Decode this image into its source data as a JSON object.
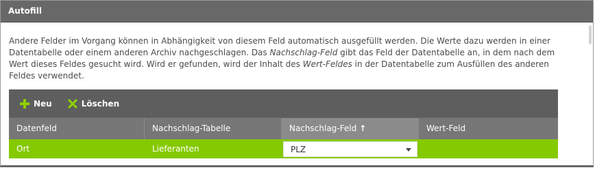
{
  "panel": {
    "title": "Autofill"
  },
  "description": {
    "part1": "Andere Felder im Vorgang können in Abhängigkeit von diesem Feld automatisch ausgefüllt werden. Die Werte dazu werden in einer Datentabelle oder einem anderen Archiv nachgeschlagen. Das ",
    "em1": "Nachschlag-Feld",
    "part2": " gibt das Feld der Datentabelle an, in dem nach dem Wert dieses Feldes gesucht wird. Wird er gefunden, wird der Inhalt des ",
    "em2": "Wert-Feldes",
    "part3": " in der Datentabelle zum Ausfüllen des anderen Feldes verwendet."
  },
  "toolbar": {
    "new_label": "Neu",
    "delete_label": "Löschen",
    "new_icon": "plus-icon",
    "delete_icon": "x-icon"
  },
  "table": {
    "columns": [
      "Datenfeld",
      "Nachschlag-Tabelle",
      "Nachschlag-Feld",
      "Wert-Feld"
    ],
    "sort_indicator": "↑",
    "rows": [
      {
        "datenfeld": "Ort",
        "nachschlag_tabelle": "Lieferanten",
        "nachschlag_feld": "PLZ",
        "wert_feld": ""
      }
    ]
  },
  "colors": {
    "header_bg": "#686868",
    "grid_bg": "#5e5e5e",
    "selected_row": "#85c900",
    "accent_green": "#8ccf00"
  }
}
